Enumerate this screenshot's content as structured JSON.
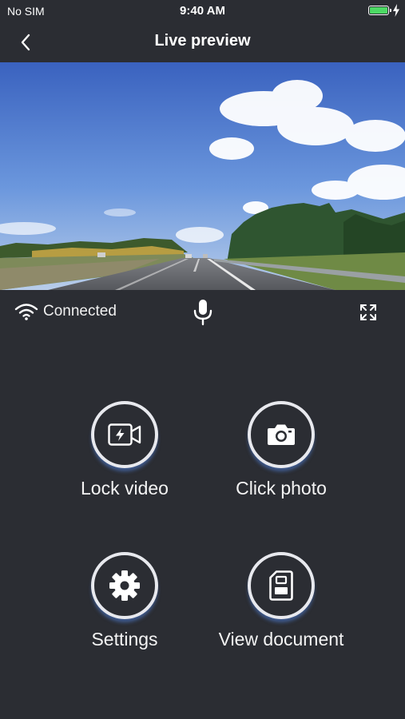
{
  "status_bar": {
    "carrier": "No SIM",
    "time": "9:40 AM",
    "battery_level_pct": 100
  },
  "nav": {
    "title": "Live preview",
    "back_icon": "chevron-left-icon"
  },
  "preview": {
    "description_icon": "camera-live-feed"
  },
  "controls": {
    "connection_status": "Connected",
    "wifi_icon": "wifi-icon",
    "mic_icon": "microphone-icon",
    "fullscreen_icon": "expand-icon"
  },
  "actions": [
    {
      "label": "Lock video",
      "icon": "lock-video-icon"
    },
    {
      "label": "Click photo",
      "icon": "camera-icon"
    },
    {
      "label": "Settings",
      "icon": "gear-icon"
    },
    {
      "label": "View document",
      "icon": "sd-card-icon"
    }
  ],
  "colors": {
    "background": "#2b2d33",
    "ring": "#e8e9ee",
    "ring_glow": "#5082dc",
    "battery": "#4cd964"
  }
}
